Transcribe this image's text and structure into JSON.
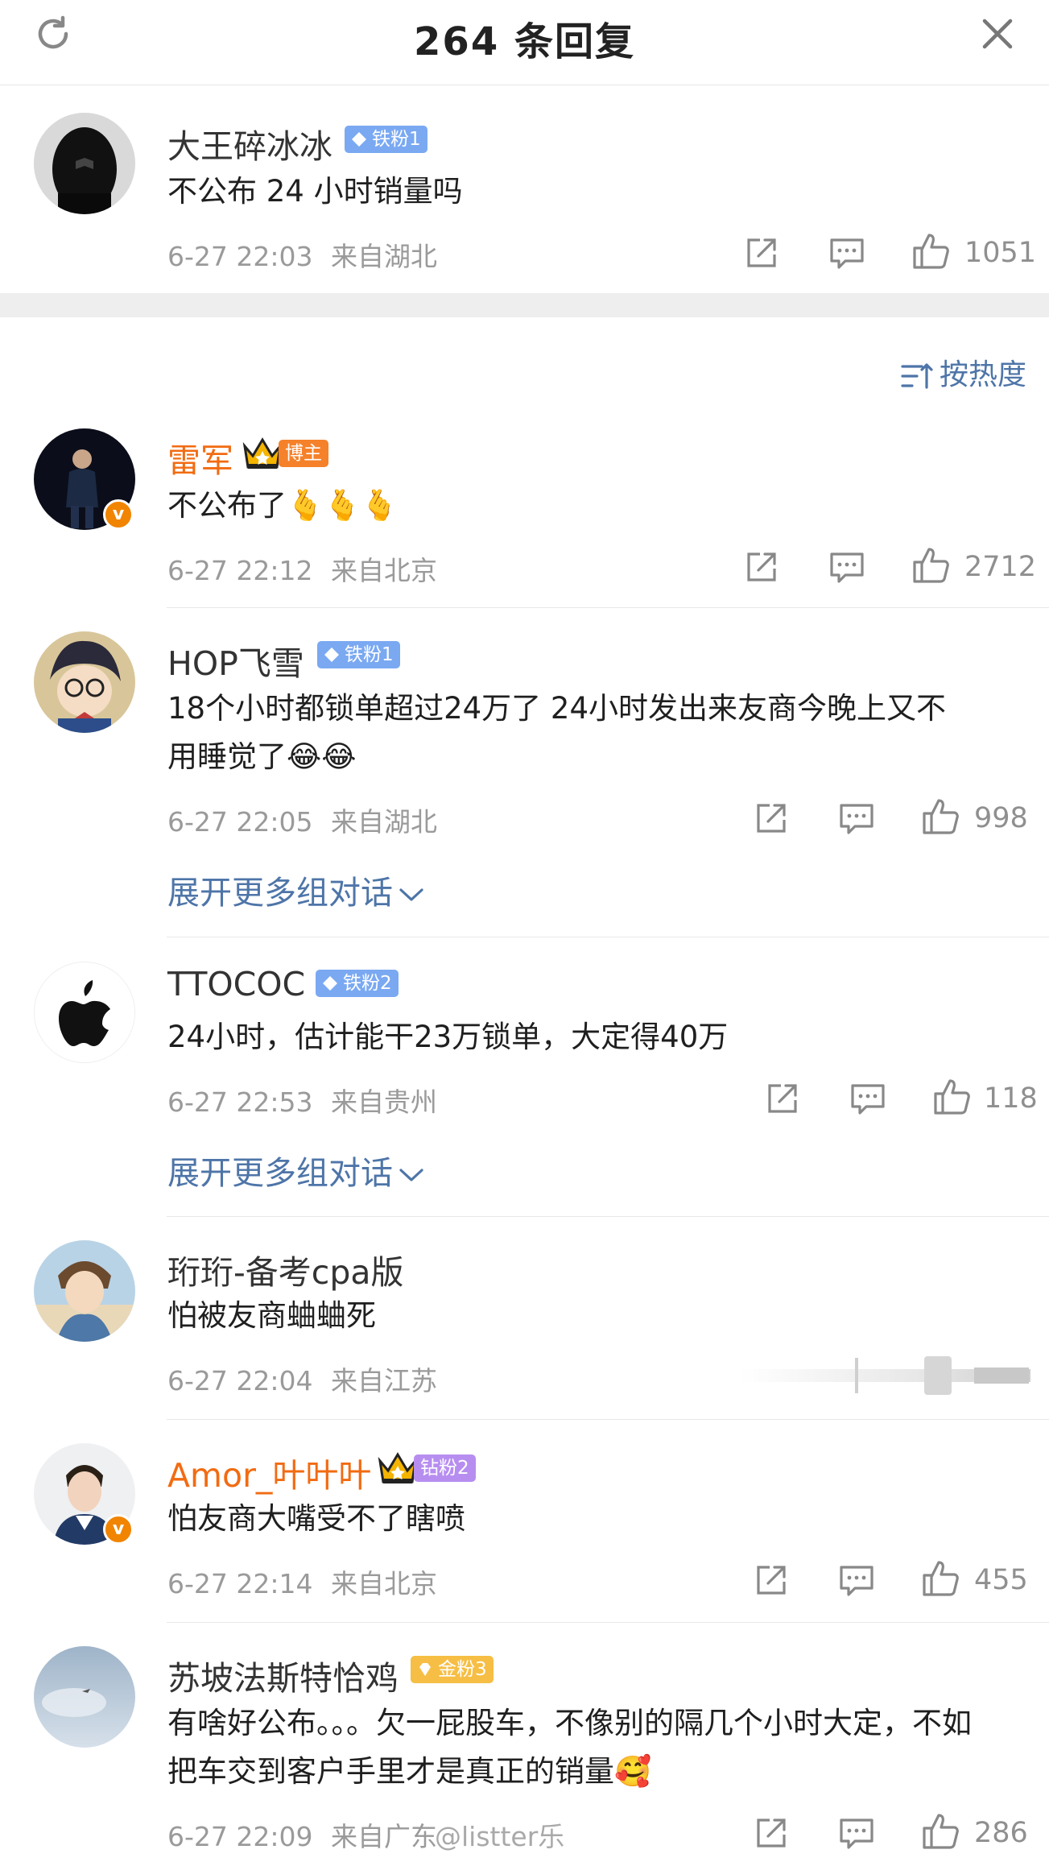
{
  "header": {
    "title": "264 条回复"
  },
  "root": {
    "name": "大王碎冰冰",
    "badge": "铁粉1",
    "text": "不公布 24 小时销量吗",
    "time": "6-27 22:03",
    "location": "来自湖北",
    "likes": "1051"
  },
  "sort_label": "按热度",
  "replies": [
    {
      "name": "雷军",
      "badge": "博主",
      "text": "不公布了🫰🫰🫰",
      "time": "6-27 22:12",
      "location": "来自北京",
      "likes": "2712"
    },
    {
      "name": "HOP飞雪",
      "badge": "铁粉1",
      "text_line1": "18个小时都锁单超过24万了   24小时发出来友商今晚上又不",
      "text_line2": "用睡觉了😂😂",
      "time": "6-27 22:05",
      "location": "来自湖北",
      "likes": "998",
      "expand": "展开更多组对话"
    },
    {
      "name": "TTOCOC",
      "badge": "铁粉2",
      "text": "24小时，估计能干23万锁单，大定得40万",
      "time": "6-27 22:53",
      "location": "来自贵州",
      "likes": "118",
      "expand": "展开更多组对话"
    },
    {
      "name": "珩珩-备考cpa版",
      "text": "怕被友商蛐蛐死",
      "time": "6-27 22:04",
      "location": "来自江苏"
    },
    {
      "name": "Amor_叶叶叶",
      "badge": "钻粉2",
      "text": "怕友商大嘴受不了瞎喷",
      "time": "6-27 22:14",
      "location": "来自北京",
      "likes": "455"
    },
    {
      "name": "苏坡法斯特恰鸡",
      "badge": "金粉3",
      "text_line1": "有啥好公布。。。欠一屁股车，不像别的隔几个小时大定，不如",
      "text_line2": "把车交到客户手里才是真正的销量🥰",
      "time": "6-27 22:09",
      "location": "来自广东",
      "likes": "286"
    }
  ],
  "watermark": "@listter乐",
  "colors": {
    "link": "#4e75a8",
    "vip_name": "#f26b12",
    "meta": "#9a9a9a"
  }
}
